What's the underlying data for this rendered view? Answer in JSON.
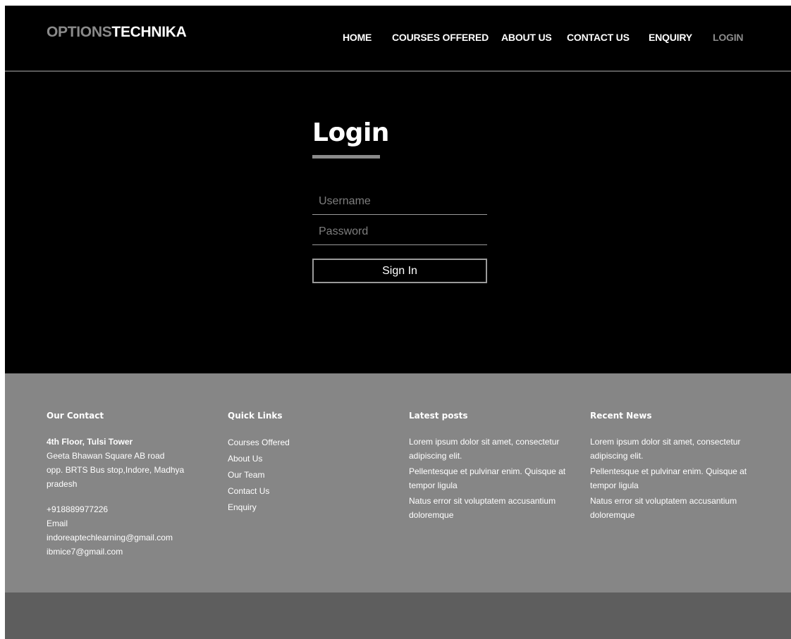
{
  "header": {
    "logo_part1": "OPTIONS",
    "logo_part2": "TECHNIKA",
    "nav": [
      {
        "label": "HOME"
      },
      {
        "label": "COURSES OFFERED"
      },
      {
        "label": "ABOUT US"
      },
      {
        "label": "CONTACT US"
      },
      {
        "label": "ENQUIRY"
      },
      {
        "label": "LOGIN"
      }
    ]
  },
  "login": {
    "title": "Login",
    "username_placeholder": "Username",
    "password_placeholder": "Password",
    "signin_label": "Sign In"
  },
  "footer": {
    "contact": {
      "heading": "Our Contact",
      "address_bold": "4th Floor, Tulsi Tower",
      "address_lines": [
        "Geeta Bhawan Square AB road",
        "opp. BRTS Bus stop,Indore, Madhya",
        "pradesh"
      ],
      "phone": "+918889977226",
      "email_label": "Email",
      "emails": [
        "indoreaptechlearning@gmail.com",
        "ibmice7@gmail.com"
      ]
    },
    "quick_links": {
      "heading": "Quick Links",
      "items": [
        "Courses Offered",
        "About Us",
        "Our Team",
        "Contact Us",
        "Enquiry"
      ]
    },
    "latest_posts": {
      "heading": "Latest posts",
      "items": [
        [
          "Lorem ipsum dolor sit amet, consectetur",
          "adipiscing elit."
        ],
        [
          "Pellentesque et pulvinar enim. Quisque at",
          "tempor ligula"
        ],
        [
          "Natus error sit voluptatem accusantium",
          "doloremque"
        ]
      ]
    },
    "recent_news": {
      "heading": "Recent News",
      "items": [
        [
          "Lorem ipsum dolor sit amet, consectetur",
          "adipiscing elit."
        ],
        [
          "Pellentesque et pulvinar enim. Quisque at",
          "tempor ligula"
        ],
        [
          "Natus error sit voluptatem accusantium",
          "doloremque"
        ]
      ]
    }
  },
  "colors": {
    "background": "#000000",
    "footer": "#868686",
    "bottom_bar": "#5e5e5e",
    "muted_text": "#8a8a8a"
  }
}
